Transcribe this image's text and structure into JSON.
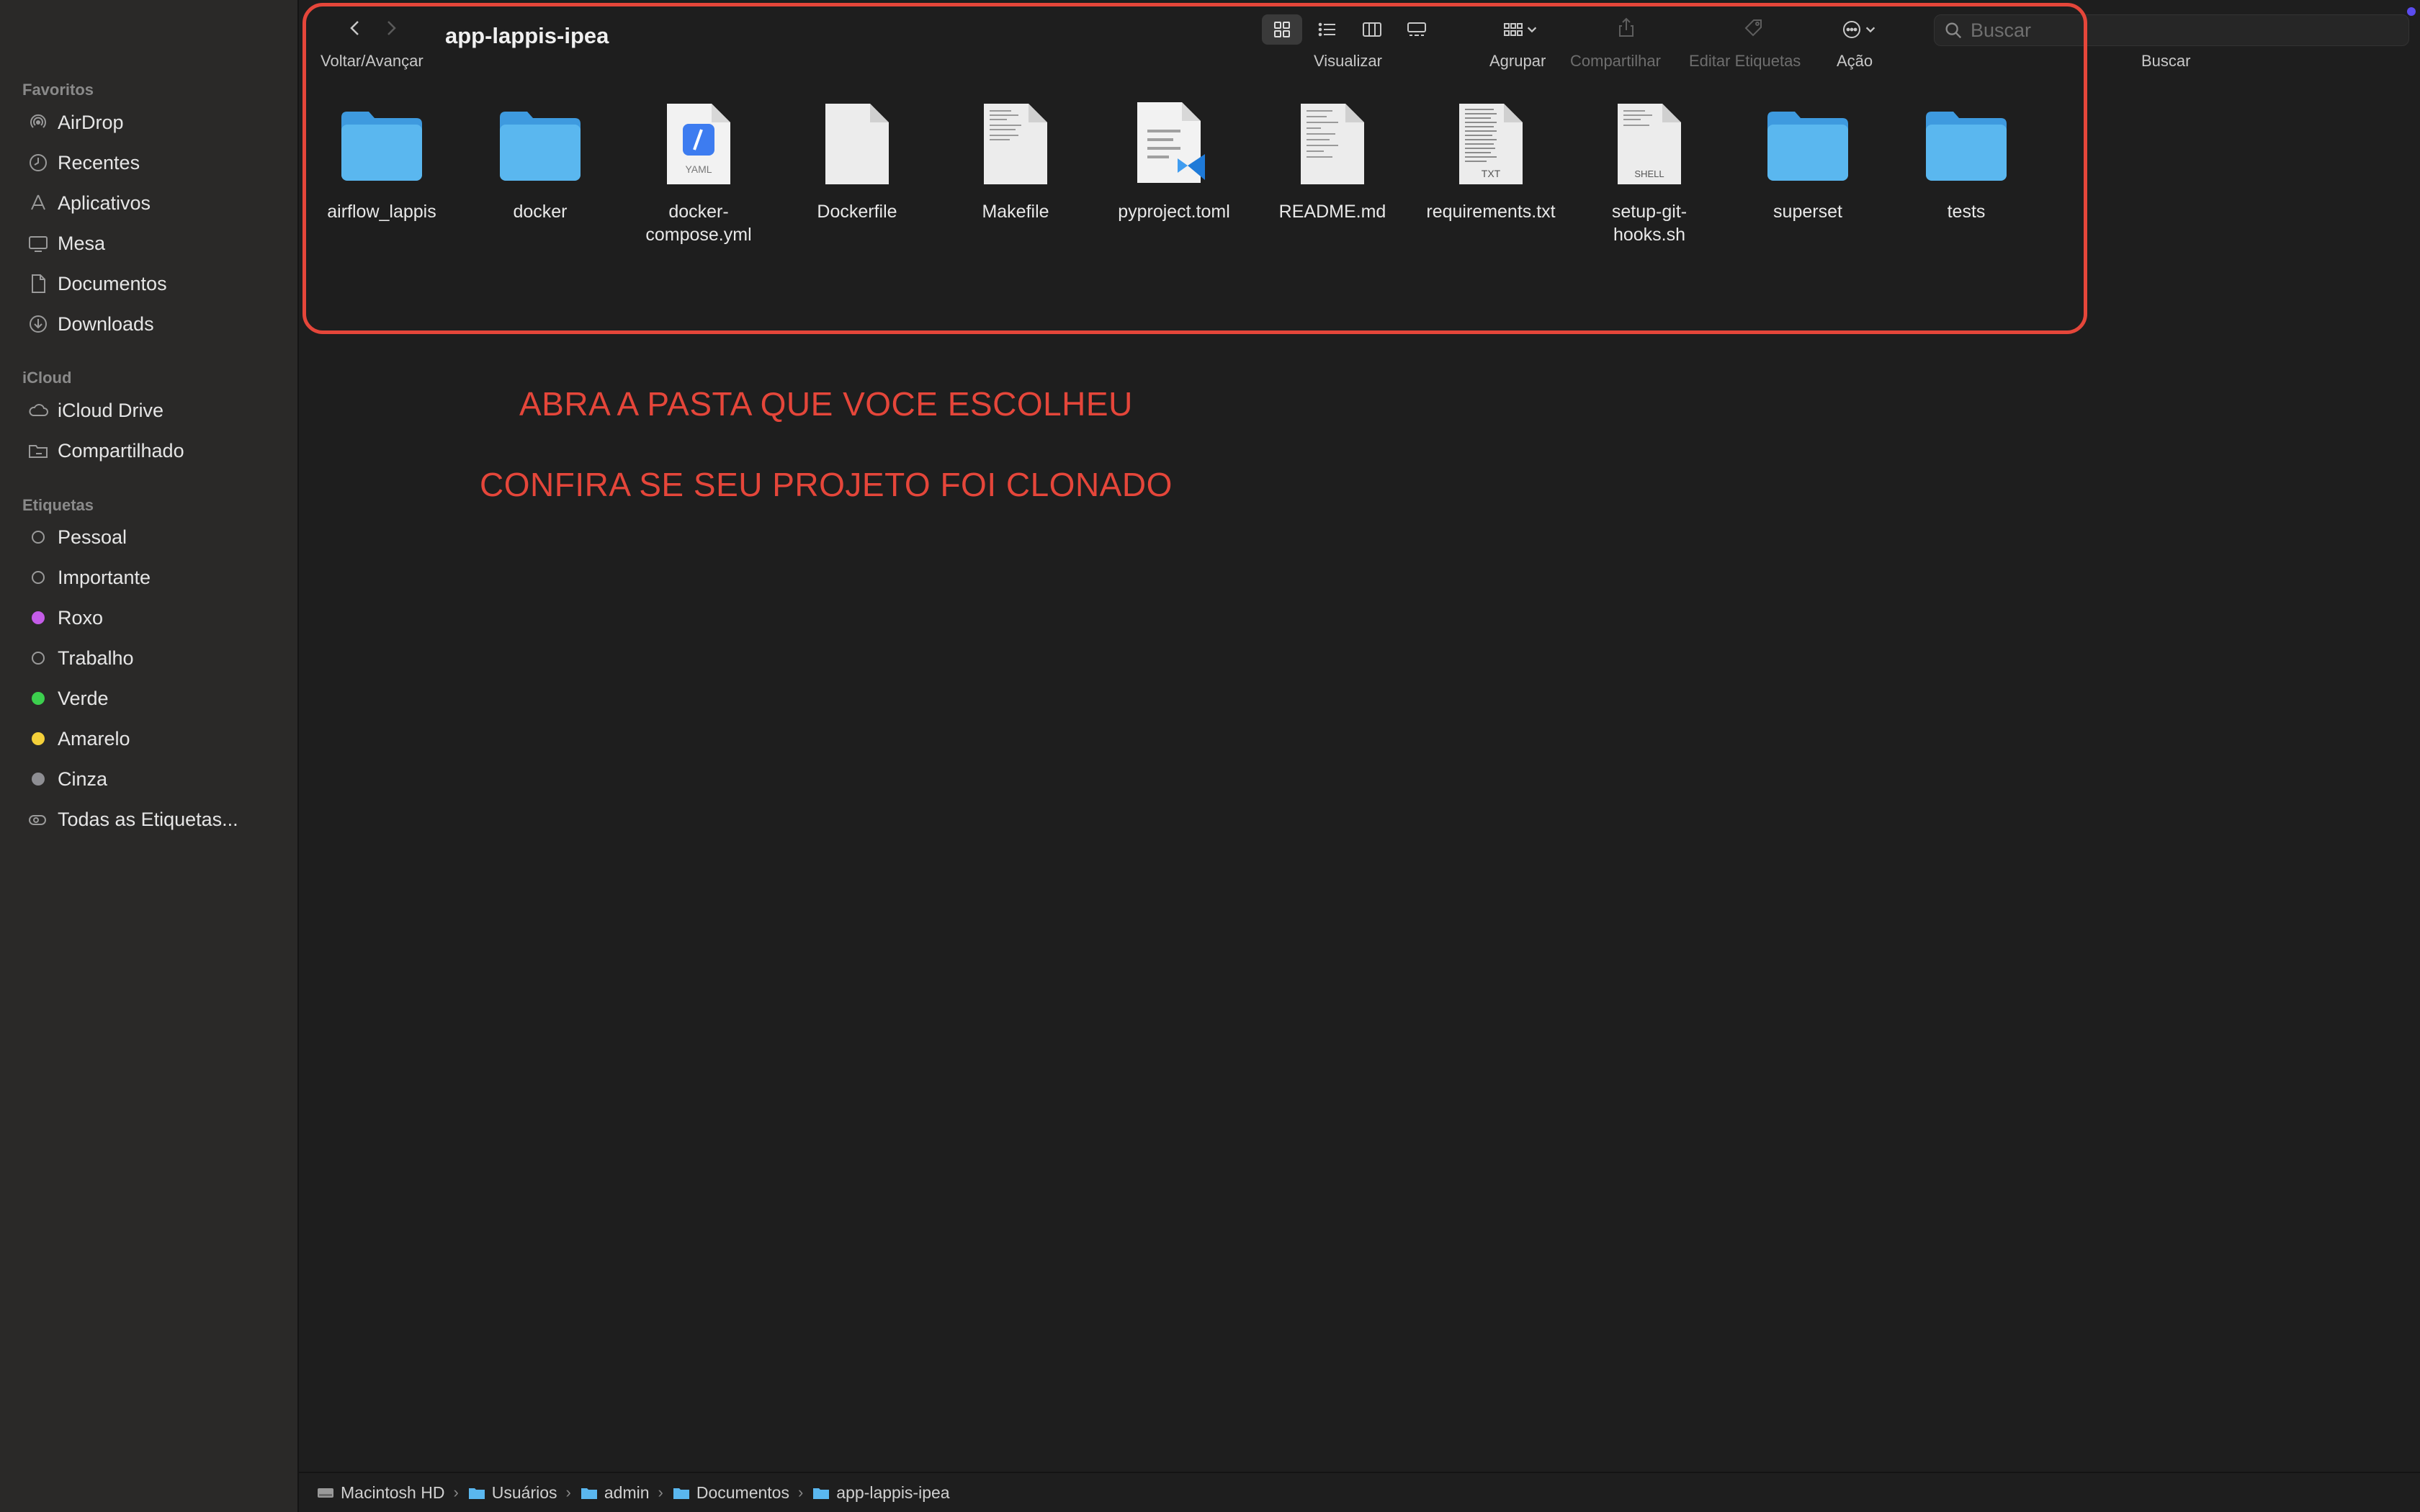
{
  "window": {
    "title": "app-lappis-ipea"
  },
  "sidebar": {
    "sections": [
      {
        "heading": "Favoritos",
        "items": [
          {
            "label": "AirDrop",
            "icon": "airdrop-icon"
          },
          {
            "label": "Recentes",
            "icon": "clock-icon"
          },
          {
            "label": "Aplicativos",
            "icon": "apps-icon"
          },
          {
            "label": "Mesa",
            "icon": "desktop-icon"
          },
          {
            "label": "Documentos",
            "icon": "document-icon"
          },
          {
            "label": "Downloads",
            "icon": "download-icon"
          }
        ]
      },
      {
        "heading": "iCloud",
        "items": [
          {
            "label": "iCloud Drive",
            "icon": "cloud-icon"
          },
          {
            "label": "Compartilhado",
            "icon": "shared-folder-icon"
          }
        ]
      },
      {
        "heading": "Etiquetas",
        "items": [
          {
            "label": "Pessoal",
            "color": ""
          },
          {
            "label": "Importante",
            "color": ""
          },
          {
            "label": "Roxo",
            "color": "#c45ce8"
          },
          {
            "label": "Trabalho",
            "color": ""
          },
          {
            "label": "Verde",
            "color": "#3ccf4e"
          },
          {
            "label": "Amarelo",
            "color": "#f4d03a"
          },
          {
            "label": "Cinza",
            "color": "#8e8e93"
          },
          {
            "label": "Todas as Etiquetas...",
            "icon": "all-tags-icon"
          }
        ]
      }
    ]
  },
  "toolbar": {
    "nav_label": "Voltar/Avançar",
    "view_label": "Visualizar",
    "group_label": "Agrupar",
    "share_label": "Compartilhar",
    "tags_label": "Editar Etiquetas",
    "action_label": "Ação",
    "search_label": "Buscar",
    "search_placeholder": "Buscar"
  },
  "files": [
    {
      "name": "airflow_lappis",
      "kind": "folder"
    },
    {
      "name": "docker",
      "kind": "folder"
    },
    {
      "name": "docker-\ncompose.yml",
      "kind": "yaml",
      "badge": "YAML"
    },
    {
      "name": "Dockerfile",
      "kind": "blank"
    },
    {
      "name": "Makefile",
      "kind": "text"
    },
    {
      "name": "pyproject.toml",
      "kind": "vscode"
    },
    {
      "name": "README.md",
      "kind": "text"
    },
    {
      "name": "requirements.txt",
      "kind": "txt",
      "badge": "TXT"
    },
    {
      "name": "setup-git-\nhooks.sh",
      "kind": "shell",
      "badge": "SHELL"
    },
    {
      "name": "superset",
      "kind": "folder"
    },
    {
      "name": "tests",
      "kind": "folder"
    }
  ],
  "annotations": [
    "ABRA A PASTA QUE VOCE ESCOLHEU",
    "CONFIRA SE SEU PROJETO FOI CLONADO"
  ],
  "pathbar": [
    "Macintosh HD",
    "Usuários",
    "admin",
    "Documentos",
    "app-lappis-ipea"
  ],
  "colors": {
    "accent_annotation": "#e5463a",
    "folder_blue": "#5ab7ef"
  }
}
